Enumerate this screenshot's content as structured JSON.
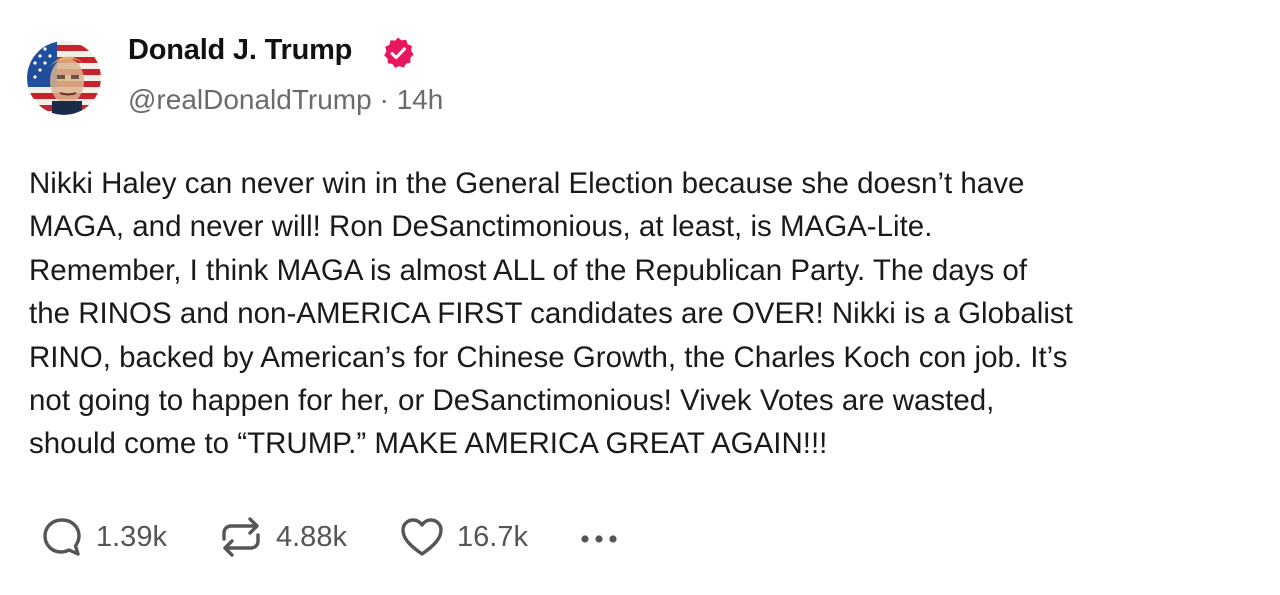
{
  "author": {
    "display_name": "Donald J. Trump",
    "handle": "@realDonaldTrump",
    "separator": "·",
    "time_ago": "14h",
    "verified": true,
    "verified_color": "#e8175d"
  },
  "post": {
    "text": "Nikki Haley can never win in the General Election because she doesn’t have\nMAGA, and never will! Ron DeSanctimonious, at least, is MAGA-Lite.\nRemember, I think MAGA is almost ALL of the Republican Party. The days of\nthe RINOS and non-AMERICA FIRST candidates are OVER! Nikki is a Globalist\nRINO, backed by American’s for Chinese Growth, the Charles Koch con job. It’s\nnot going to happen for her, or DeSanctimonious! Vivek Votes are wasted,\nshould come to “TRUMP.” MAKE AMERICA GREAT AGAIN!!!"
  },
  "actions": {
    "replies": {
      "icon": "reply-icon",
      "count": "1.39k"
    },
    "reposts": {
      "icon": "repost-icon",
      "count": "4.88k"
    },
    "likes": {
      "icon": "heart-icon",
      "count": "16.7k"
    },
    "more": {
      "icon": "more-icon"
    }
  },
  "colors": {
    "text": "#1a1a1a",
    "muted": "#6b6b6b",
    "icon": "#555555"
  }
}
